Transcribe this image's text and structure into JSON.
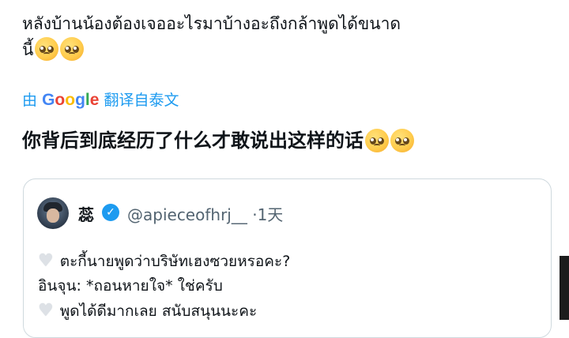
{
  "post": {
    "text_line1": "หลังบ้านน้องต้องเจออะไรมาบ้างอะถึงกล้าพูดได้ขนาด",
    "text_line2": "นี้",
    "emoji": "pleading-face"
  },
  "translation": {
    "prefix": "由",
    "brand": "Google",
    "suffix": "翻译自泰文",
    "translated_text": "你背后到底经历了什么才敢说出这样的话"
  },
  "quoted_post": {
    "author_name": "蕊",
    "handle": "@apieceofhrj__",
    "separator": "·",
    "time": "1天",
    "lines": [
      {
        "icon": "white-heart",
        "text": "ตะกี้นายพูดว่าบริษัทเฮงซวยหรอคะ?"
      },
      {
        "icon": "",
        "text": "อินจุน: *ถอนหายใจ* ใช่ครับ"
      },
      {
        "icon": "white-heart",
        "text": "พูดได้ดีมากเลย สนับสนุนนะคะ"
      }
    ]
  },
  "colors": {
    "link": "#1d9bf0",
    "text": "#0f1419",
    "muted": "#536471",
    "border": "#cfd9de"
  }
}
